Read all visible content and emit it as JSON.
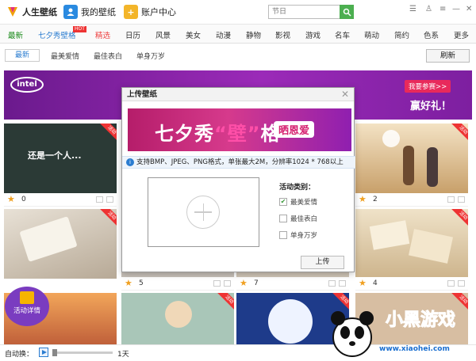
{
  "app": {
    "title": "人生壁纸",
    "nav": [
      {
        "label": "我的壁纸",
        "icon": "person-icon",
        "color": "#2a8ae0"
      },
      {
        "label": "账户中心",
        "icon": "plus-icon",
        "color": "#f3b52a"
      }
    ]
  },
  "search": {
    "placeholder": "节日"
  },
  "categories": [
    {
      "label": "最新",
      "state": "active"
    },
    {
      "label": "七夕秀壁格",
      "badge": "HOT",
      "state": "normal"
    },
    {
      "label": "精选",
      "state": "red"
    },
    {
      "label": "日历"
    },
    {
      "label": "风景"
    },
    {
      "label": "美女"
    },
    {
      "label": "动漫"
    },
    {
      "label": "静物"
    },
    {
      "label": "影视"
    },
    {
      "label": "游戏"
    },
    {
      "label": "名车"
    },
    {
      "label": "萌动"
    },
    {
      "label": "简约"
    },
    {
      "label": "色系"
    },
    {
      "label": "更多"
    }
  ],
  "subtabs": [
    "最新",
    "最美爱情",
    "最佳表白",
    "单身万岁"
  ],
  "refresh_label": "刷新",
  "banner": {
    "brand": "intel",
    "tag": "我要参赛>>",
    "prize": "赢好礼！"
  },
  "tiles": [
    {
      "text": "还是一个人...",
      "badge": "活动",
      "count": "0",
      "bg": "#2b3a36"
    },
    {
      "text": "",
      "badge": "活动",
      "count": "",
      "bg": "#e3e3e3"
    },
    {
      "text": "",
      "badge": "活动",
      "count": "",
      "bg": "#c9e4f2"
    },
    {
      "text": "",
      "badge": "活动",
      "count": "2",
      "bg": "#d8c3a3"
    },
    {
      "text": "",
      "badge": "活动",
      "count": "",
      "bg": "#d9cdbb"
    },
    {
      "text": "",
      "badge": "活动",
      "count": "5",
      "bg": "#c7c0b8"
    },
    {
      "text": "",
      "badge": "活动",
      "count": "7",
      "bg": "#cfc5b6"
    },
    {
      "text": "",
      "badge": "活动",
      "count": "4",
      "bg": "#e0cfb1"
    },
    {
      "text": "",
      "badge": "",
      "count": "",
      "bg": "#e08a4a"
    },
    {
      "text": "",
      "badge": "活动",
      "count": "",
      "bg": "#8fb4a0"
    },
    {
      "text": "",
      "badge": "活动",
      "count": "",
      "bg": "#1e3b8a"
    },
    {
      "text": "",
      "badge": "活动",
      "count": "",
      "bg": "#d7bea2"
    }
  ],
  "dialog": {
    "title": "上传壁纸",
    "banner_title_a": "七夕秀",
    "banner_title_b": "“壁”",
    "banner_title_c": "格",
    "banner_sub": "晒恩爱",
    "info": "支持BMP、JPEG、PNG格式，单张最大2M，分辨率1024 * 768以上",
    "category_label": "活动类别：",
    "options": [
      {
        "label": "最美爱情",
        "checked": true
      },
      {
        "label": "最佳表白",
        "checked": false
      },
      {
        "label": "单身万岁",
        "checked": false
      }
    ],
    "upload_label": "上传"
  },
  "event_button": "活动详情",
  "bottombar": {
    "auto_label": "自动换：",
    "interval": "1天"
  },
  "watermark": {
    "title": "小黑游戏",
    "url": "www.xiaohei.com"
  }
}
